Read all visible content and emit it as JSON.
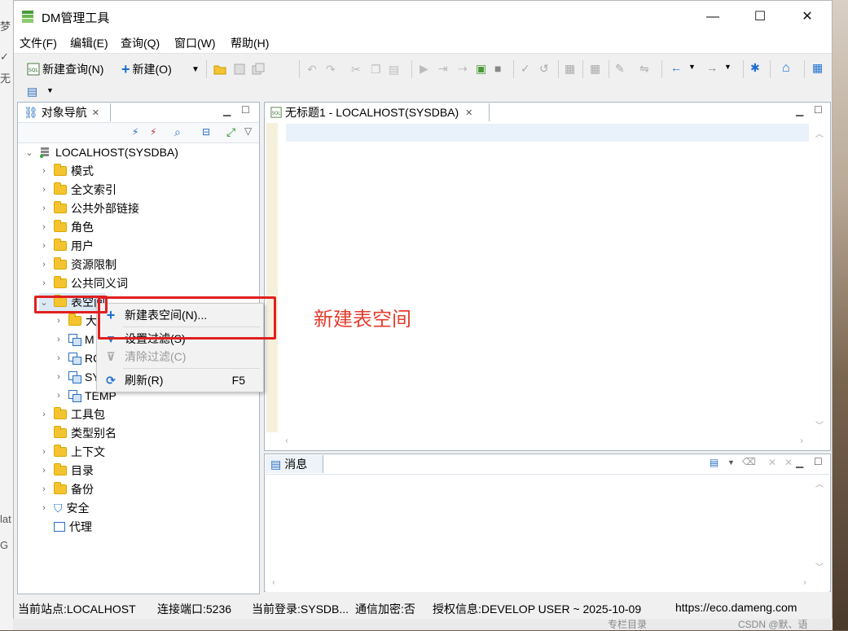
{
  "window": {
    "title": "DM管理工具",
    "controls": {
      "minimize": "—",
      "maximize": "☐",
      "close": "✕"
    }
  },
  "background": {
    "left_fragments": [
      "梦",
      "✓",
      "无",
      "lat",
      "G"
    ],
    "bottom_fragments": [
      "CSDN @默、语",
      "专栏目录"
    ]
  },
  "menu": [
    "文件(F)",
    "编辑(E)",
    "查询(Q)",
    "窗口(W)",
    "帮助(H)"
  ],
  "toolbar": {
    "new_query": "新建查询(N)",
    "new": "新建(O)",
    "new_dropdown": "▼"
  },
  "navigator": {
    "tab_label": "对象导航",
    "tree": {
      "root": "LOCALHOST(SYSDBA)",
      "items": [
        "模式",
        "全文索引",
        "公共外部链接",
        "角色",
        "用户",
        "资源限制",
        "公共同义词",
        "表空间"
      ],
      "tablespace_children": [
        "大",
        "M",
        "RC",
        "SY",
        "TEMP"
      ],
      "items_after": [
        "工具包",
        "类型别名",
        "上下文",
        "目录",
        "备份",
        "安全",
        "代理"
      ]
    }
  },
  "editor": {
    "tab_label": "无标题1 - LOCALHOST(SYSDBA)"
  },
  "messages": {
    "tab_label": "消息"
  },
  "context_menu": {
    "items": [
      {
        "label": "新建表空间(N)...",
        "shortcut": "",
        "icon": "plus-icon",
        "enabled": true
      },
      {
        "label": "设置过滤(S)",
        "shortcut": "",
        "icon": "filter-icon",
        "enabled": true
      },
      {
        "label": "清除过滤(C)",
        "shortcut": "",
        "icon": "clear-filter-icon",
        "enabled": false
      },
      {
        "label": "刷新(R)",
        "shortcut": "F5",
        "icon": "refresh-icon",
        "enabled": true
      }
    ]
  },
  "annotation": {
    "text": "新建表空间",
    "color": "#e53d2e"
  },
  "statusbar": {
    "site": "当前站点:LOCALHOST",
    "port": "连接端口:5236",
    "login": "当前登录:SYSDB...",
    "encrypt": "通信加密:否",
    "license": "授权信息:DEVELOP USER ~ 2025-10-09",
    "url": "https://eco.dameng.com"
  },
  "colors": {
    "accent": "#2a6fbf",
    "folder": "#f4c430",
    "annotation_red": "#e02020"
  }
}
